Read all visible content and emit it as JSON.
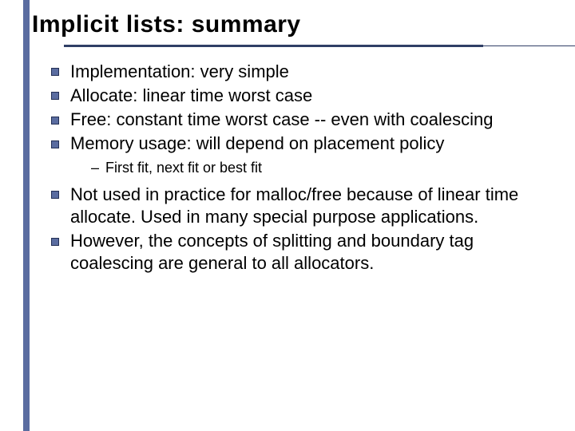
{
  "title": "Implicit lists: summary",
  "bullets": {
    "b1": "Implementation: very simple",
    "b2": "Allocate: linear time worst case",
    "b3": "Free: constant time worst case -- even with coalescing",
    "b4": "Memory usage: will depend on placement policy",
    "b4_sub1": "First fit, next fit or best fit",
    "b5": "Not used in practice for malloc/free because of linear time allocate.  Used in many special purpose applications.",
    "b6": "However, the concepts of splitting and boundary tag coalescing are general to all allocators."
  }
}
